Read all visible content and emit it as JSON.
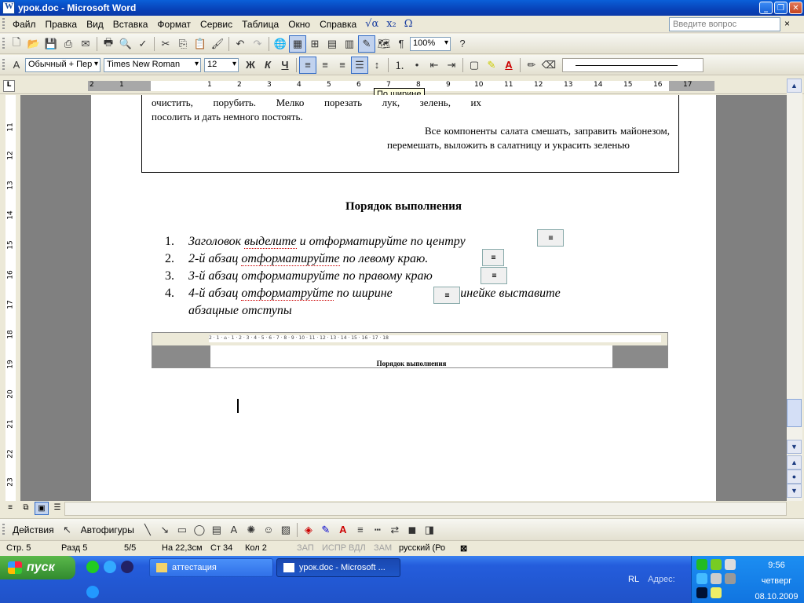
{
  "window": {
    "title": "урок.doc - Microsoft Word"
  },
  "menu": {
    "items": [
      "Файл",
      "Правка",
      "Вид",
      "Вставка",
      "Формат",
      "Сервис",
      "Таблица",
      "Окно",
      "Справка"
    ],
    "extras": [
      "√α",
      "x₂",
      "Ω"
    ],
    "ask_placeholder": "Введите вопрос",
    "close_glyph": "×"
  },
  "standard_toolbar": {
    "zoom": "100%"
  },
  "format_toolbar": {
    "style": "Обычный + Пер",
    "font": "Times New Roman",
    "size": "12",
    "bold": "Ж",
    "italic": "К",
    "underline": "Ч"
  },
  "ruler": {
    "tooltip": "По ширине",
    "corner": "L"
  },
  "document": {
    "recipe": {
      "line1": "очистить, порубить. Мелко порезать лук, зелень, их",
      "line2": "посолить и дать немного постоять.",
      "right_paragraph": "Все компоненты салата смешать, заправить майонезом, перемешать, выложить в салатницу и украсить зеленью"
    },
    "heading": "Порядок выполнения",
    "steps": [
      {
        "num": "1.",
        "parts": [
          "Заголовок ",
          "выделите",
          " и отформатируйте по центру"
        ]
      },
      {
        "num": "2.",
        "parts": [
          "2-й абзац ",
          "отформатируйте",
          " по левому краю."
        ]
      },
      {
        "num": "3.",
        "parts": [
          "3-й абзац отформатируйте по правому краю"
        ]
      },
      {
        "num": "4.",
        "parts": [
          "4-й абзац ",
          "отформатруйте",
          " по ширине",
          ".На линейке выставите"
        ]
      }
    ],
    "step4_cont": "абзацные отступы",
    "embedded_title": "Порядок выполнения"
  },
  "drawing_toolbar": {
    "actions": "Действия",
    "autoshapes": "Автофигуры"
  },
  "status": {
    "page": "Стр. 5",
    "section": "Разд 5",
    "pages": "5/5",
    "at": "На 22,3см",
    "line": "Ст 34",
    "col": "Кол 2",
    "rec": "ЗАП",
    "trk": "ИСПР",
    "ext": "ВДЛ",
    "ovr": "ЗАМ",
    "lang": "русский (Ро"
  },
  "taskbar": {
    "start": "пуск",
    "buttons": [
      {
        "label": "аттестация",
        "active": false
      },
      {
        "label": "урок.doc - Microsoft ...",
        "active": true
      }
    ],
    "lang": "RL",
    "address": "Адрес:",
    "time": "9:56",
    "day": "четверг",
    "date": "08.10.2009"
  }
}
